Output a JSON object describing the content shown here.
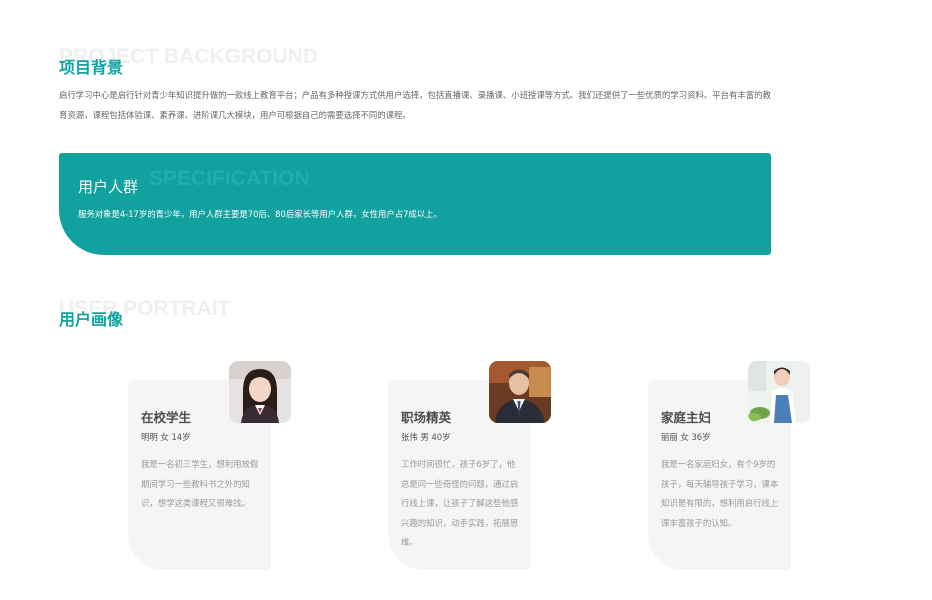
{
  "background": {
    "title_en": "PROJECT BACKGROUND",
    "title": "项目背景",
    "description": "启行学习中心是启行针对青少年知识提升做的一款线上教育平台；产品有多种授课方式供用户选择，包括直播课、录播课、小班授课等方式。我们还提供了一些优质的学习资料。平台有丰富的教育资源，课程包括体验课、素养课、进阶课几大模块，用户可根据自己的需要选择不同的课程。"
  },
  "specification": {
    "title_en": "SPECIFICATION",
    "title": "用户人群",
    "description": "服务对象是4-17岁的青少年，用户人群主要是70后、80后家长等用户人群，女性用户占7成以上。"
  },
  "portrait": {
    "title_en": "USER PORTRAIT",
    "title": "用户画像",
    "personas": [
      {
        "role": "在校学生",
        "meta": "明明  女  14岁",
        "description": "我是一名初三学生，想利用放假期间学习一些教科书之外的知识，想学这类课程又很难找。"
      },
      {
        "role": "职场精英",
        "meta": "张伟  男  40岁",
        "description": "工作时间很忙，孩子6岁了，他总是问一些奇怪的问题，通过启行线上课，让孩子了解这些他感兴趣的知识，动手实践，拓展思维。"
      },
      {
        "role": "家庭主妇",
        "meta": "丽丽  女  36岁",
        "description": "我是一名家庭妇女，有个9岁的孩子，每天辅导孩子学习，课本知识是有限的，想利用启行线上课丰富孩子的认知。"
      }
    ]
  },
  "colors": {
    "accent": "#12a3a3",
    "card_bg": "#f5f5f5"
  }
}
